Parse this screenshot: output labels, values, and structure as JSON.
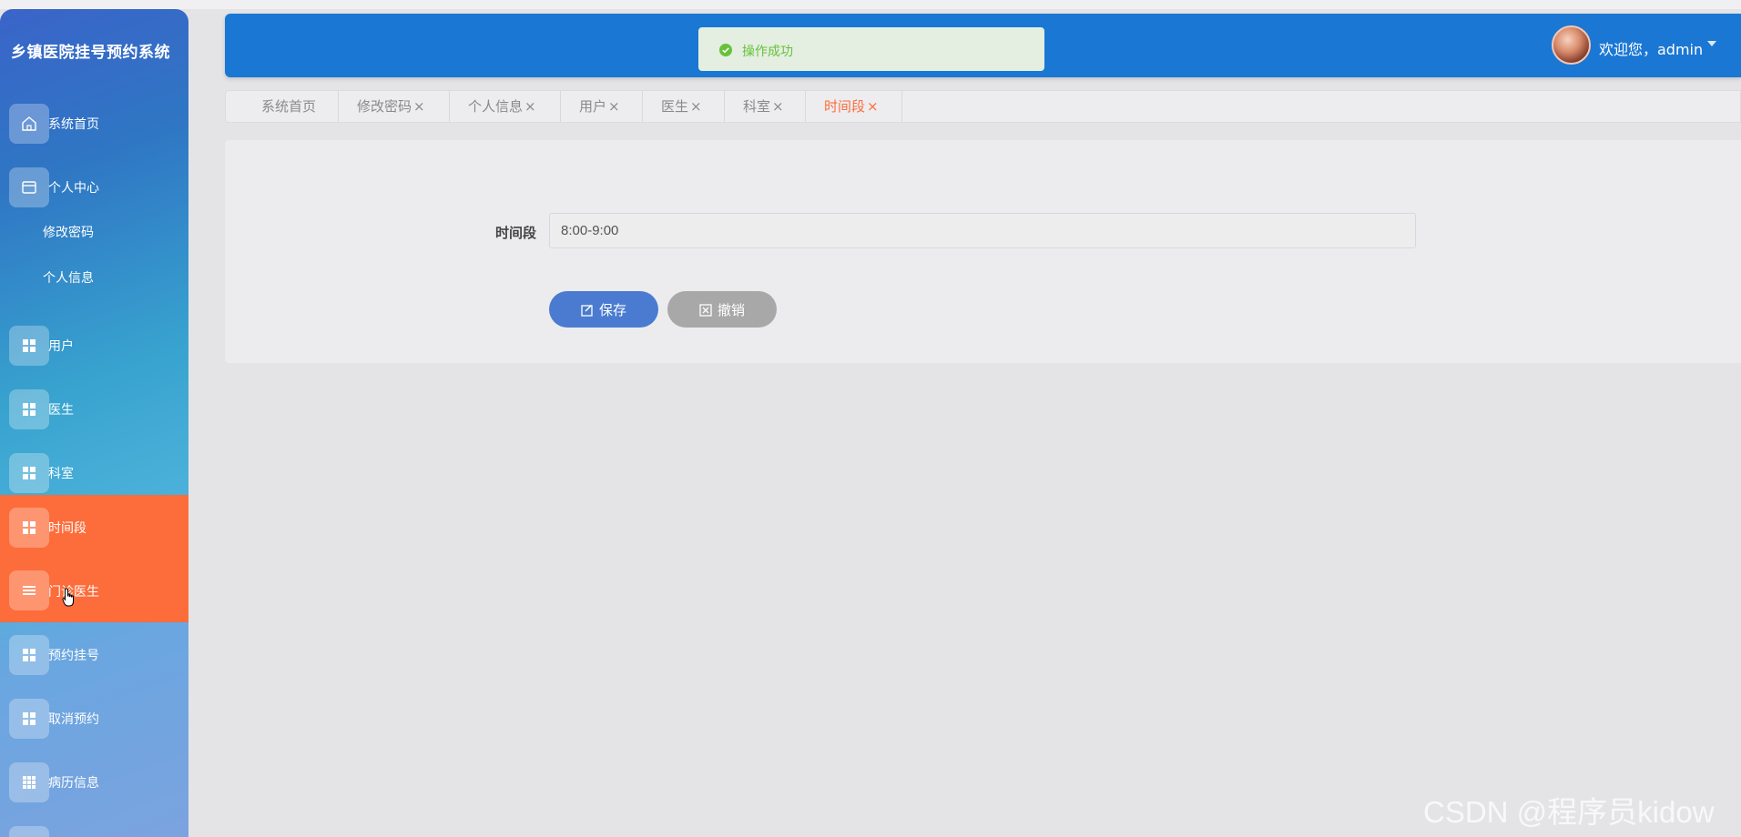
{
  "app": {
    "title": "乡镇医院挂号预约系统"
  },
  "sidebar": {
    "items": [
      {
        "label": "系统首页",
        "icon": "home-icon"
      },
      {
        "label": "个人中心",
        "icon": "card-icon"
      },
      {
        "label": "用户",
        "icon": "grid-icon"
      },
      {
        "label": "医生",
        "icon": "grid-icon"
      },
      {
        "label": "科室",
        "icon": "grid-icon"
      },
      {
        "label": "时间段",
        "icon": "grid-icon",
        "active": true
      },
      {
        "label": "门诊医生",
        "icon": "list-icon"
      },
      {
        "label": "预约挂号",
        "icon": "grid-icon"
      },
      {
        "label": "取消预约",
        "icon": "grid-icon"
      },
      {
        "label": "病历信息",
        "icon": "table-icon"
      }
    ],
    "sub_items": [
      "修改密码",
      "个人信息"
    ],
    "active_color": "#fd6c3b"
  },
  "header": {
    "toast": "操作成功",
    "welcome": "欢迎您，admin",
    "accent_color": "#1b77d4"
  },
  "tabs": [
    {
      "label": "系统首页",
      "close": ""
    },
    {
      "label": "修改密码",
      "close": "×"
    },
    {
      "label": "个人信息",
      "close": "×"
    },
    {
      "label": "用户",
      "close": "×"
    },
    {
      "label": "医生",
      "close": "×"
    },
    {
      "label": "科室",
      "close": "×"
    },
    {
      "label": "时间段",
      "close": "×",
      "active": true
    }
  ],
  "form": {
    "field_label": "时间段",
    "field_value": "8:00-9:00",
    "save_label": "保存",
    "cancel_label": "撤销"
  },
  "watermark": "CSDN @程序员kidow"
}
